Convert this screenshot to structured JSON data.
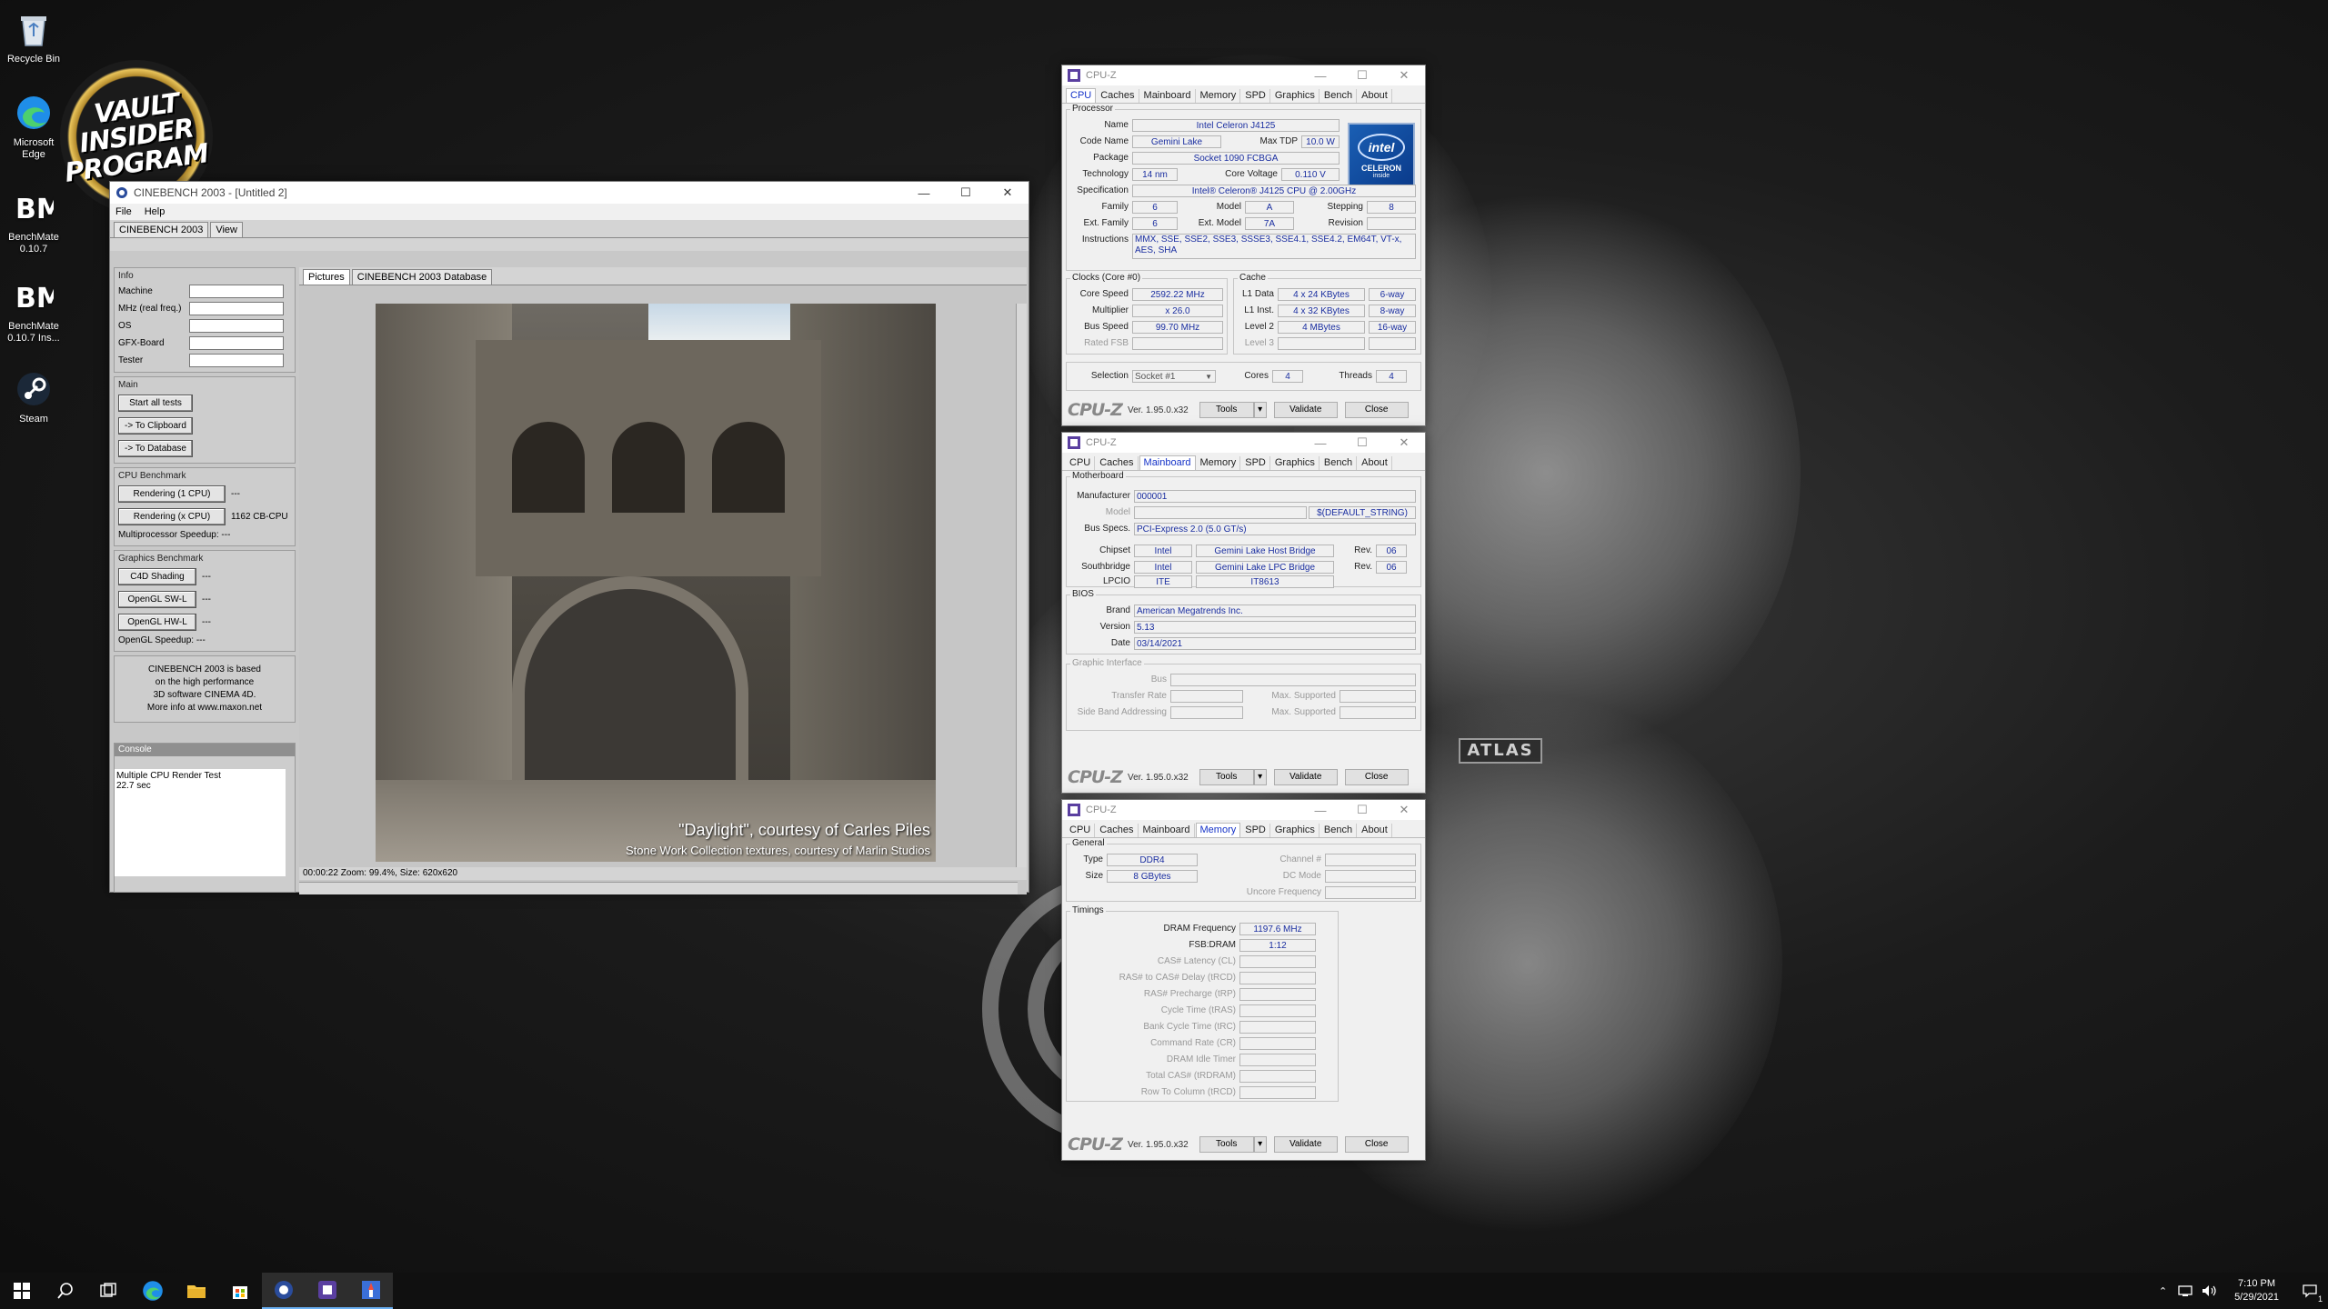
{
  "desktop": {
    "icons": [
      {
        "label": "Recycle Bin",
        "icon": "recycle-bin-icon"
      },
      {
        "label": "Microsoft Edge",
        "icon": "edge-icon"
      },
      {
        "label": "BenchMate 0.10.7",
        "icon": "benchmate-icon"
      },
      {
        "label": "BenchMate 0.10.7 Ins...",
        "icon": "benchmate-icon"
      },
      {
        "label": "Steam",
        "icon": "steam-icon"
      }
    ],
    "vault_lines": [
      "VAULT",
      "INSIDER",
      "PROGRAM"
    ],
    "atlas_text": "ATLAS"
  },
  "cinebench": {
    "title": "CINEBENCH 2003 - [Untitled 2]",
    "menu": [
      "File",
      "Help"
    ],
    "tabs_top": [
      "CINEBENCH 2003",
      "View"
    ],
    "info": {
      "header": "Info",
      "rows": [
        "Machine",
        "MHz (real freq.)",
        "OS",
        "GFX-Board",
        "Tester"
      ]
    },
    "main": {
      "header": "Main",
      "start_all": "Start all tests",
      "to_clipboard": "-> To Clipboard",
      "to_database": "-> To Database"
    },
    "cpu": {
      "header": "CPU Benchmark",
      "r1_label": "Rendering (1 CPU)",
      "r1_value": "---",
      "rx_label": "Rendering (x CPU)",
      "rx_value": "1162 CB-CPU",
      "mp_label": "Multiprocessor Speedup:",
      "mp_value": "---"
    },
    "gfx": {
      "header": "Graphics Benchmark",
      "c4d": "C4D Shading",
      "c4d_value": "---",
      "sw": "OpenGL SW-L",
      "sw_value": "---",
      "hw": "OpenGL HW-L",
      "hw_value": "---",
      "speedup_label": "OpenGL Speedup:",
      "speedup_value": "---"
    },
    "about_lines": [
      "CINEBENCH 2003 is based",
      "on the high performance",
      "3D software CINEMA 4D.",
      "More info at www.maxon.net"
    ],
    "picture_tabs": [
      "Pictures",
      "CINEBENCH 2003 Database"
    ],
    "caption1": "\"Daylight\", courtesy of Carles Piles",
    "caption2": "Stone Work Collection textures, courtesy of Marlin Studios",
    "status": "00:00:22  Zoom: 99.4%, Size: 620x620",
    "console": {
      "header": "Console",
      "lines": [
        "Multiple CPU Render Test",
        "22.7 sec"
      ]
    }
  },
  "cpuz_common": {
    "title": "CPU-Z",
    "tabs": [
      "CPU",
      "Caches",
      "Mainboard",
      "Memory",
      "SPD",
      "Graphics",
      "Bench",
      "About"
    ],
    "logo": "CPU-Z",
    "version": "Ver. 1.95.0.x32",
    "tools": "Tools",
    "validate": "Validate",
    "close": "Close"
  },
  "cpuz_cpu": {
    "processor_header": "Processor",
    "name_label": "Name",
    "name": "Intel Celeron J4125",
    "codename_label": "Code Name",
    "codename": "Gemini Lake",
    "maxtdp_label": "Max TDP",
    "maxtdp": "10.0 W",
    "package_label": "Package",
    "package": "Socket 1090 FCBGA",
    "tech_label": "Technology",
    "tech": "14 nm",
    "voltage_label": "Core Voltage",
    "voltage": "0.110 V",
    "spec_label": "Specification",
    "spec": "Intel® Celeron® J4125 CPU @ 2.00GHz",
    "family_label": "Family",
    "family": "6",
    "model_label": "Model",
    "model": "A",
    "stepping_label": "Stepping",
    "stepping": "8",
    "extfamily_label": "Ext. Family",
    "extfamily": "6",
    "extmodel_label": "Ext. Model",
    "extmodel": "7A",
    "revision_label": "Revision",
    "revision": "",
    "instr_label": "Instructions",
    "instr": "MMX, SSE, SSE2, SSE3, SSSE3, SSE4.1, SSE4.2, EM64T, VT-x, AES, SHA",
    "clocks_header": "Clocks (Core #0)",
    "corespeed_label": "Core Speed",
    "corespeed": "2592.22 MHz",
    "mult_label": "Multiplier",
    "mult": "x 26.0",
    "bus_label": "Bus Speed",
    "bus": "99.70 MHz",
    "fsb_label": "Rated FSB",
    "cache_header": "Cache",
    "l1d_label": "L1 Data",
    "l1d": "4 x 24 KBytes",
    "l1d_way": "6-way",
    "l1i_label": "L1 Inst.",
    "l1i": "4 x 32 KBytes",
    "l1i_way": "8-way",
    "l2_label": "Level 2",
    "l2": "4 MBytes",
    "l2_way": "16-way",
    "l3_label": "Level 3",
    "selection_label": "Selection",
    "selection": "Socket #1",
    "cores_label": "Cores",
    "cores": "4",
    "threads_label": "Threads",
    "threads": "4",
    "intel_logo": [
      "intel",
      "CELERON",
      "inside"
    ]
  },
  "cpuz_mb": {
    "mb_header": "Motherboard",
    "manufacturer_label": "Manufacturer",
    "manufacturer": "000001",
    "model_label": "Model",
    "model": "",
    "model_extra": "$(DEFAULT_STRING)",
    "busspecs_label": "Bus Specs.",
    "busspecs": "PCI-Express 2.0 (5.0 GT/s)",
    "chipset_label": "Chipset",
    "chipset_vendor": "Intel",
    "chipset_name": "Gemini Lake Host Bridge",
    "chipset_rev": "06",
    "south_label": "Southbridge",
    "south_vendor": "Intel",
    "south_name": "Gemini Lake LPC Bridge",
    "south_rev": "06",
    "rev_label": "Rev.",
    "lpcio_label": "LPCIO",
    "lpcio_vendor": "ITE",
    "lpcio_name": "IT8613",
    "bios_header": "BIOS",
    "brand_label": "Brand",
    "brand": "American Megatrends Inc.",
    "version_label": "Version",
    "version": "5.13",
    "date_label": "Date",
    "date": "03/14/2021",
    "gi_header": "Graphic Interface",
    "gi_bus": "Bus",
    "gi_rate": "Transfer Rate",
    "gi_max1": "Max. Supported",
    "gi_side": "Side Band Addressing",
    "gi_max2": "Max. Supported"
  },
  "cpuz_mem": {
    "general_header": "General",
    "type_label": "Type",
    "type": "DDR4",
    "size_label": "Size",
    "size": "8 GBytes",
    "channel_label": "Channel #",
    "dcmode_label": "DC Mode",
    "uncore_label": "Uncore Frequency",
    "timings_header": "Timings",
    "dram_label": "DRAM Frequency",
    "dram": "1197.6 MHz",
    "fsb_label": "FSB:DRAM",
    "fsb": "1:12",
    "dim_rows": [
      "CAS# Latency (CL)",
      "RAS# to CAS# Delay (tRCD)",
      "RAS# Precharge (tRP)",
      "Cycle Time (tRAS)",
      "Bank Cycle Time (tRC)",
      "Command Rate (CR)",
      "DRAM Idle Timer",
      "Total CAS# (tRDRAM)",
      "Row To Column (tRCD)"
    ]
  },
  "taskbar": {
    "icons": [
      "start-icon",
      "search-icon",
      "task-view-icon",
      "edge-icon",
      "file-explorer-icon",
      "store-icon",
      "cinebench-icon",
      "cpuz-icon",
      "benchmate-icon"
    ],
    "time": "7:10 PM",
    "date": "5/29/2021",
    "notification_count": "1"
  }
}
